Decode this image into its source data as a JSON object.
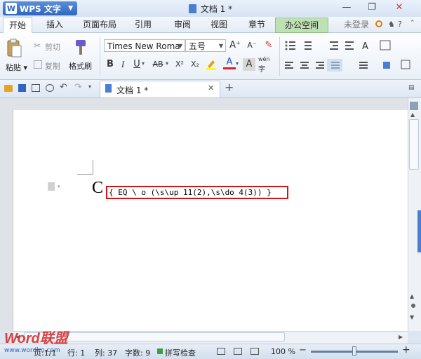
{
  "titlebar": {
    "app_name": "WPS 文字",
    "doc_title": "文档 1 *"
  },
  "menu": {
    "tabs": [
      "开始",
      "插入",
      "页面布局",
      "引用",
      "审阅",
      "视图",
      "章节",
      "办公空间"
    ],
    "active_tab": "开始",
    "login": "未登录"
  },
  "ribbon": {
    "paste": "粘贴",
    "cut": "剪切",
    "copy": "复制",
    "format_painter": "格式刷",
    "font_name": "Times New Roma",
    "font_size": "五号",
    "bold": "B",
    "italic": "I",
    "underline": "U",
    "strike": "AB",
    "superscript": "X²",
    "subscript": "X₂",
    "font_color": "A",
    "char_shade": "A",
    "pinyin": "wén",
    "grow_font": "A⁺",
    "shrink_font": "A⁻"
  },
  "doc_tabs": {
    "tab_label": "文档 1 *"
  },
  "document": {
    "big_char": "C",
    "field_code": "{ EQ \\ o (\\s\\up 11(2),\\s\\do 4(3)) }"
  },
  "status": {
    "page_info": "页:1/1",
    "line": "行: 1",
    "col": "列: 37",
    "word_count": "字数: 9",
    "spell_check": "拼写检查",
    "zoom": "100 %",
    "zoom_level": 0.5
  },
  "watermark": {
    "brand": "Word联盟",
    "url": "www.wordlm.com"
  }
}
